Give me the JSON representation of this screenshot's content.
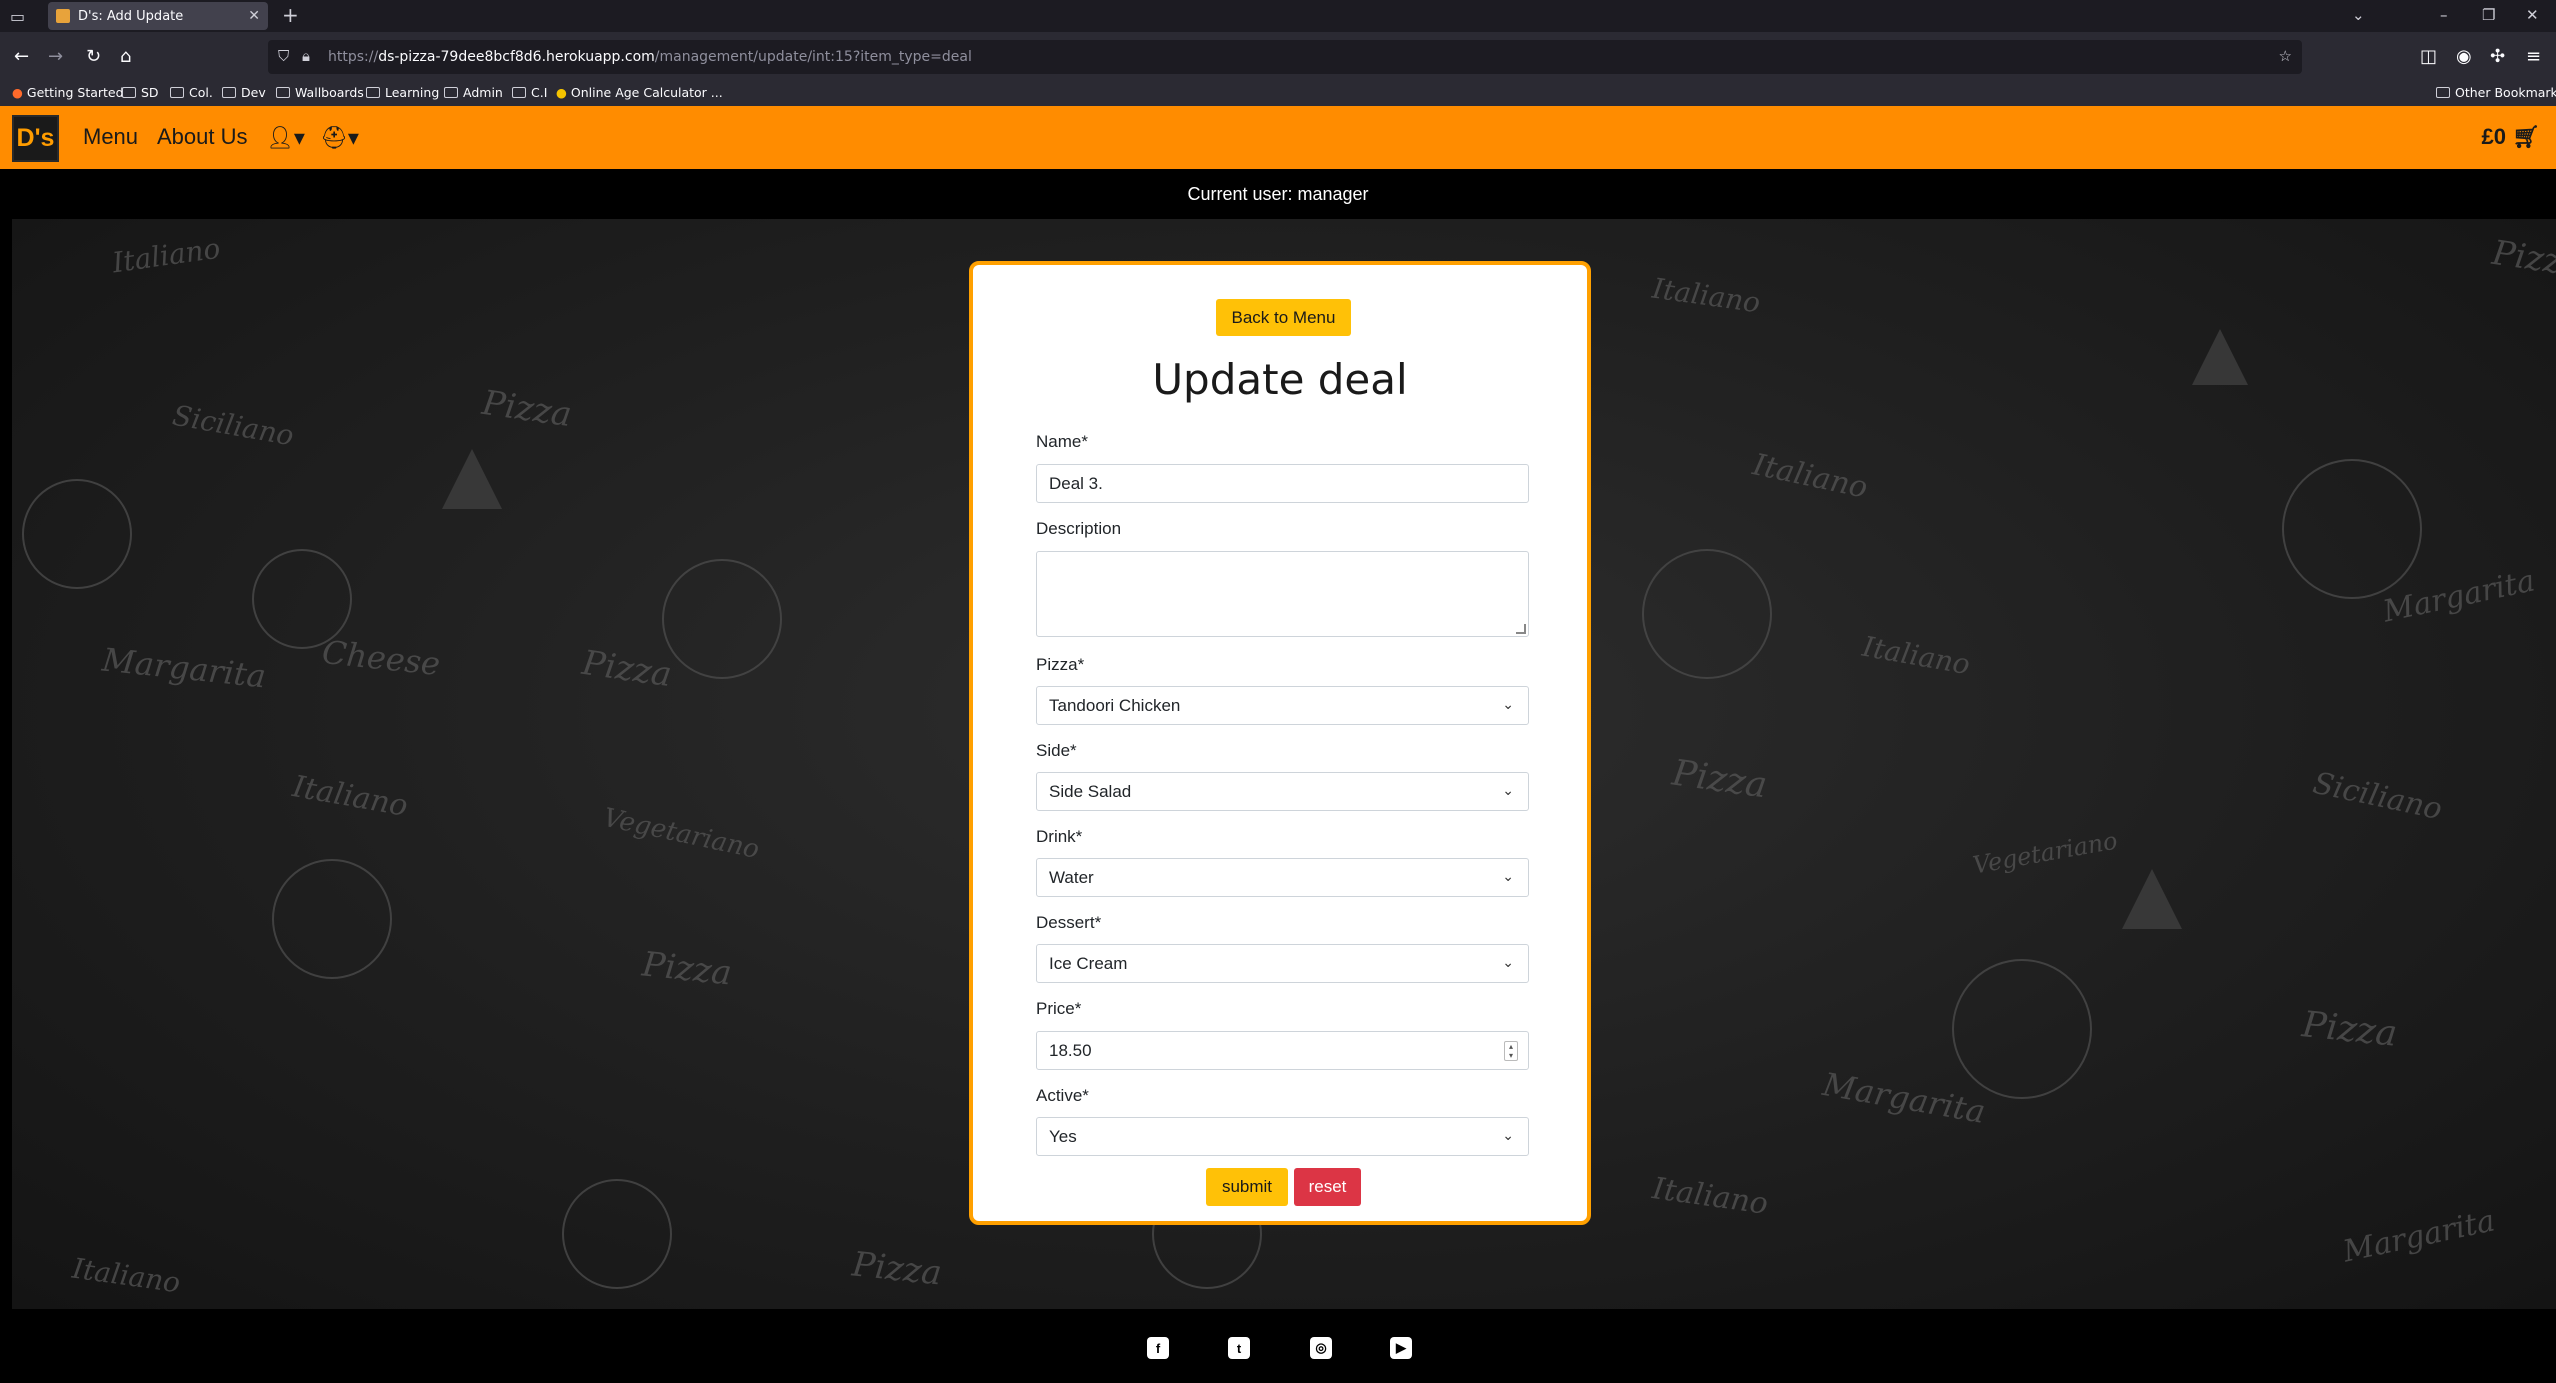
{
  "browser": {
    "tab_title": "D's: Add Update",
    "url_prefix": "https://",
    "url_host": "ds-pizza-79dee8bcf8d6.herokuapp.com",
    "url_path": "/management/update/int:15?item_type=deal",
    "bookmarks": [
      "Getting Started",
      "SD",
      "Col.",
      "Dev",
      "Wallboards",
      "Learning",
      "Admin",
      "C.I",
      "Online Age Calculator ...",
      "Other Bookmarks"
    ]
  },
  "site": {
    "logo": "D's",
    "nav": {
      "menu": "Menu",
      "about": "About Us"
    },
    "cart_total": "£0",
    "current_user": "Current user: manager"
  },
  "form": {
    "back_label": "Back to Menu",
    "title": "Update deal",
    "name_label": "Name*",
    "name_value": "Deal 3.",
    "description_label": "Description",
    "description_value": "",
    "pizza_label": "Pizza*",
    "pizza_value": "Tandoori Chicken",
    "side_label": "Side*",
    "side_value": "Side Salad",
    "drink_label": "Drink*",
    "drink_value": "Water",
    "dessert_label": "Dessert*",
    "dessert_value": "Ice Cream",
    "price_label": "Price*",
    "price_value": "18.50",
    "active_label": "Active*",
    "active_value": "Yes",
    "submit_label": "submit",
    "reset_label": "reset"
  },
  "background_words": [
    "Italiano",
    "Siciliano",
    "Pizza",
    "Margarita",
    "Cheese",
    "Vegetariano"
  ],
  "colors": {
    "brand": "#ff8c00",
    "card_border": "#ffa000",
    "button_primary": "#ffc107",
    "button_reset": "#dc3545"
  }
}
